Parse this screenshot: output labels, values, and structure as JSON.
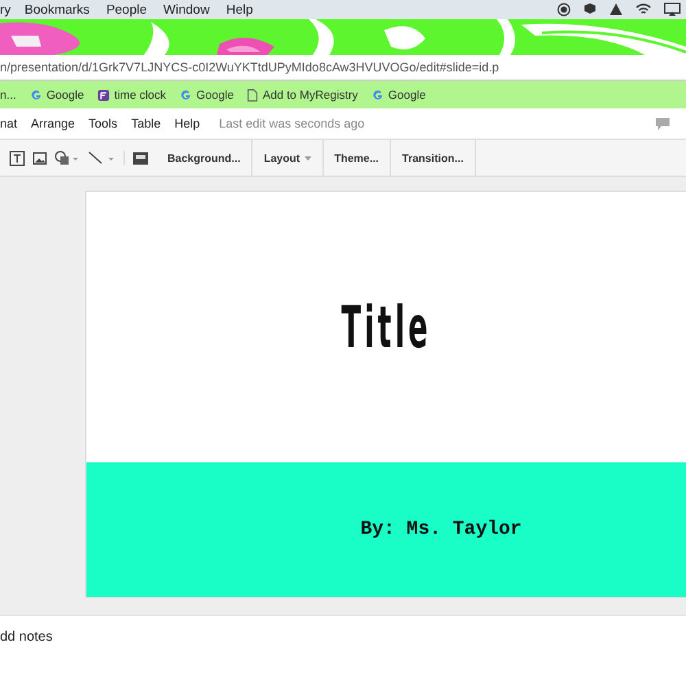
{
  "menu_bar": {
    "items": [
      "ry",
      "Bookmarks",
      "People",
      "Window",
      "Help"
    ]
  },
  "browser": {
    "address": "n/presentation/d/1Grk7V7LJNYCS-c0I2WuYKTtdUPyMIdo8cAw3HVUVOGo/edit#slide=id.p",
    "bookmarks": [
      {
        "label": "n...",
        "kind": "folder"
      },
      {
        "label": "Google",
        "kind": "google"
      },
      {
        "label": "time clock",
        "kind": "app"
      },
      {
        "label": "Google",
        "kind": "google"
      },
      {
        "label": "Add to MyRegistry",
        "kind": "page"
      },
      {
        "label": "Google",
        "kind": "google"
      }
    ]
  },
  "app_menu": {
    "items": [
      "nat",
      "Arrange",
      "Tools",
      "Table",
      "Help"
    ],
    "status": "Last edit was seconds ago"
  },
  "toolbar": {
    "buttons": [
      {
        "label": "Background...",
        "dropdown": false
      },
      {
        "label": "Layout",
        "dropdown": true
      },
      {
        "label": "Theme...",
        "dropdown": false
      },
      {
        "label": "Transition...",
        "dropdown": false
      }
    ]
  },
  "slide": {
    "title": "Title",
    "subtitle": "By: Ms. Taylor"
  },
  "notes": {
    "placeholder": "dd notes"
  }
}
